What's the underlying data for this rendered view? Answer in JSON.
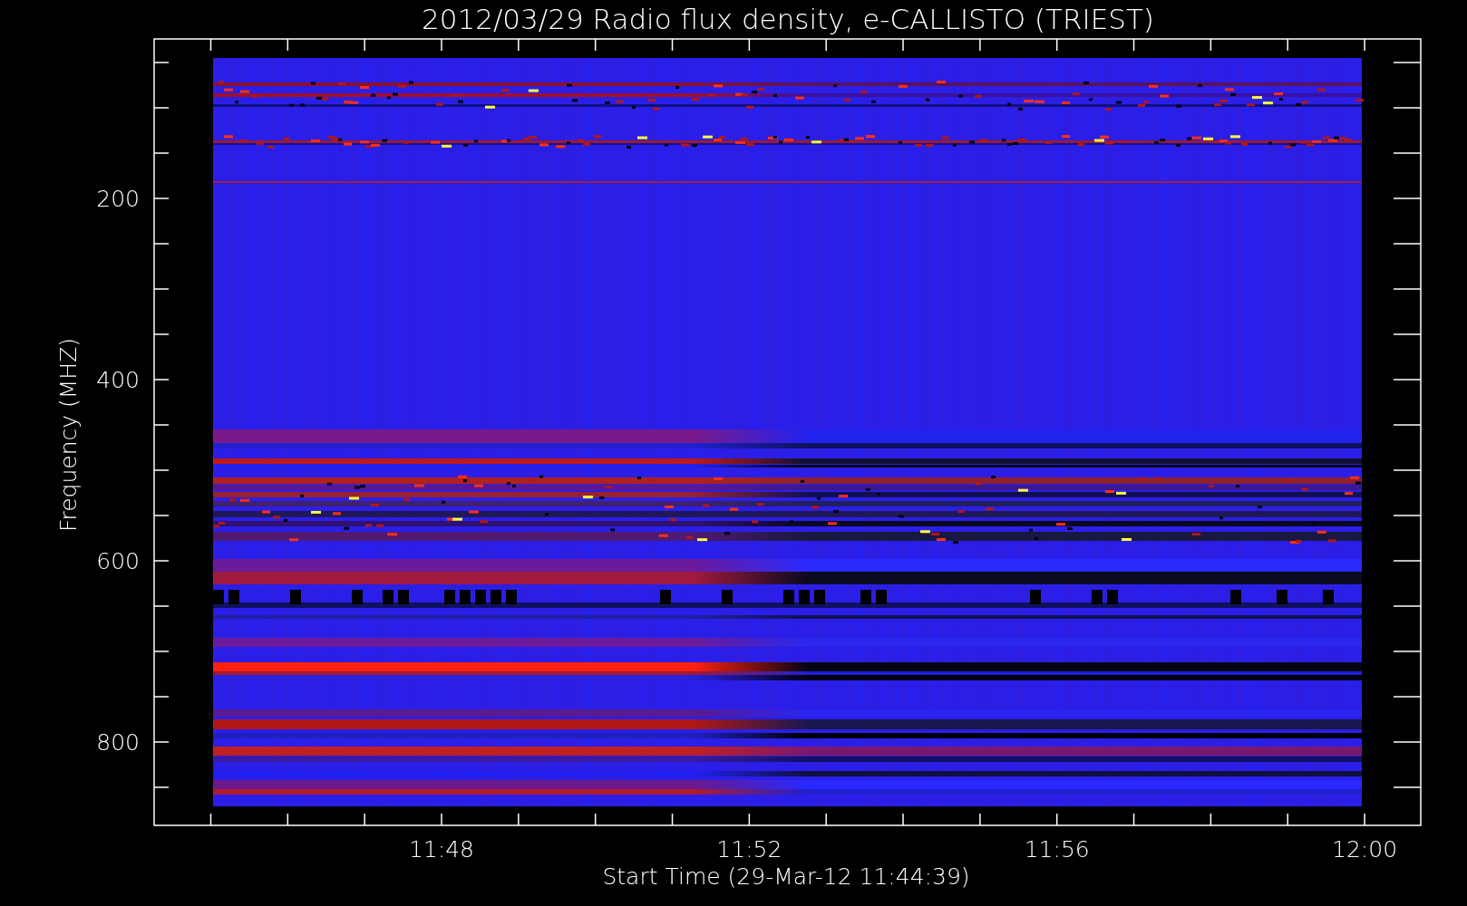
{
  "title": "2012/03/29  Radio flux density, e-CALLISTO (TRIEST)",
  "y_axis": {
    "label": "Frequency (MHZ)",
    "ticks": [
      "200",
      "400",
      "600",
      "800"
    ]
  },
  "x_axis": {
    "label": "Start Time (29-Mar-12 11:44:39)",
    "ticks": [
      "11:48",
      "11:52",
      "11:56",
      "12:00"
    ]
  }
}
